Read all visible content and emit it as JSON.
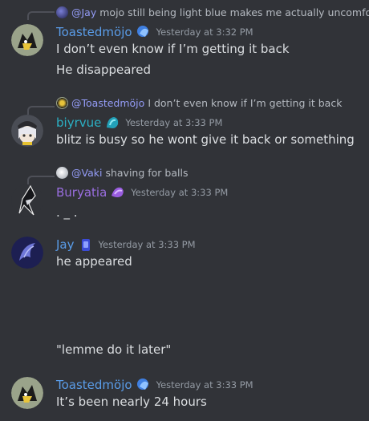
{
  "colors": {
    "background": "#313338",
    "name_blue": "#5a9ce8",
    "name_teal": "#2bb0c4",
    "name_purple": "#9a6ee0",
    "mention": "#949cf7",
    "timestamp": "#949ba4"
  },
  "messages": [
    {
      "reply": {
        "mention": "@Jay",
        "text": "mojo still being light blue makes me actually uncomforta"
      },
      "author": "Toastedmöjo",
      "badge": "blue-role-icon",
      "time": "Yesterday at 3:32 PM",
      "lines": [
        "I don’t even know if I’m getting it back",
        "He disappeared"
      ]
    },
    {
      "reply": {
        "mention": "@Toastedmöjo",
        "text": "I don’t even know if I’m getting it back"
      },
      "author": "biyrvue",
      "badge": "teal-role-icon",
      "time": "Yesterday at 3:33 PM",
      "lines": [
        "blitz is busy so he wont give it back or something"
      ]
    },
    {
      "reply": {
        "mention": "@Vaki",
        "text": "shaving for balls"
      },
      "author": "Buryatia",
      "badge": "purple-role-icon",
      "time": "Yesterday at 3:33 PM",
      "lines": [
        ". _ ."
      ]
    },
    {
      "author": "Jay",
      "badge": "blue-jar-icon",
      "time": "Yesterday at 3:33 PM",
      "lines": [
        "he appeared",
        "\"lemme do it later\""
      ]
    },
    {
      "author": "Toastedmöjo",
      "badge": "blue-role-icon",
      "time": "Yesterday at 3:33 PM",
      "lines": [
        "It’s been nearly 24 hours"
      ]
    }
  ]
}
